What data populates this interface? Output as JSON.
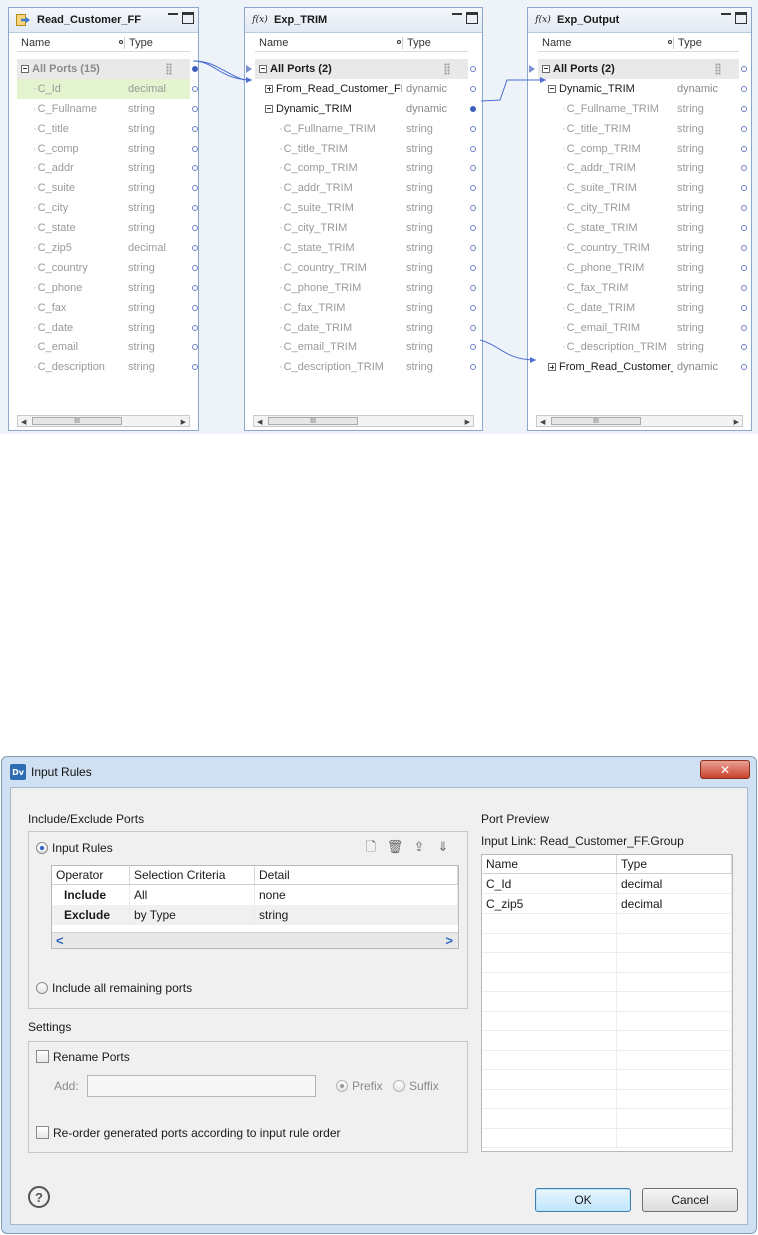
{
  "mapping": {
    "transformations": [
      {
        "title": "Read_Customer_FF",
        "col_name": "Name",
        "col_type": "Type",
        "group": {
          "label": "All Ports (15)"
        },
        "rows": [
          {
            "name": "C_Id",
            "type": "decimal"
          },
          {
            "name": "C_Fullname",
            "type": "string"
          },
          {
            "name": "C_title",
            "type": "string"
          },
          {
            "name": "C_comp",
            "type": "string"
          },
          {
            "name": "C_addr",
            "type": "string"
          },
          {
            "name": "C_suite",
            "type": "string"
          },
          {
            "name": "C_city",
            "type": "string"
          },
          {
            "name": "C_state",
            "type": "string"
          },
          {
            "name": "C_zip5",
            "type": "decimal"
          },
          {
            "name": "C_country",
            "type": "string"
          },
          {
            "name": "C_phone",
            "type": "string"
          },
          {
            "name": "C_fax",
            "type": "string"
          },
          {
            "name": "C_date",
            "type": "string"
          },
          {
            "name": "C_email",
            "type": "string"
          },
          {
            "name": "C_description",
            "type": "string"
          }
        ]
      },
      {
        "title": "Exp_TRIM",
        "icon": "f(x)",
        "col_name": "Name",
        "col_type": "Type",
        "group": {
          "label": "All Ports (2)"
        },
        "rows": [
          {
            "name": "From_Read_Customer_FF",
            "type": "dynamic",
            "kind": "collapsed"
          },
          {
            "name": "Dynamic_TRIM",
            "type": "dynamic",
            "kind": "expanded"
          },
          {
            "name": "C_Fullname_TRIM",
            "type": "string"
          },
          {
            "name": "C_title_TRIM",
            "type": "string"
          },
          {
            "name": "C_comp_TRIM",
            "type": "string"
          },
          {
            "name": "C_addr_TRIM",
            "type": "string"
          },
          {
            "name": "C_suite_TRIM",
            "type": "string"
          },
          {
            "name": "C_city_TRIM",
            "type": "string"
          },
          {
            "name": "C_state_TRIM",
            "type": "string"
          },
          {
            "name": "C_country_TRIM",
            "type": "string"
          },
          {
            "name": "C_phone_TRIM",
            "type": "string"
          },
          {
            "name": "C_fax_TRIM",
            "type": "string"
          },
          {
            "name": "C_date_TRIM",
            "type": "string"
          },
          {
            "name": "C_email_TRIM",
            "type": "string"
          },
          {
            "name": "C_description_TRIM",
            "type": "string"
          }
        ]
      },
      {
        "title": "Exp_Output",
        "icon": "f(x)",
        "col_name": "Name",
        "col_type": "Type",
        "group": {
          "label": "All Ports (2)"
        },
        "rows": [
          {
            "name": "Dynamic_TRIM",
            "type": "dynamic",
            "kind": "expanded"
          },
          {
            "name": "C_Fullname_TRIM",
            "type": "string"
          },
          {
            "name": "C_title_TRIM",
            "type": "string"
          },
          {
            "name": "C_comp_TRIM",
            "type": "string"
          },
          {
            "name": "C_addr_TRIM",
            "type": "string"
          },
          {
            "name": "C_suite_TRIM",
            "type": "string"
          },
          {
            "name": "C_city_TRIM",
            "type": "string"
          },
          {
            "name": "C_state_TRIM",
            "type": "string"
          },
          {
            "name": "C_country_TRIM",
            "type": "string"
          },
          {
            "name": "C_phone_TRIM",
            "type": "string"
          },
          {
            "name": "C_fax_TRIM",
            "type": "string"
          },
          {
            "name": "C_date_TRIM",
            "type": "string"
          },
          {
            "name": "C_email_TRIM",
            "type": "string"
          },
          {
            "name": "C_description_TRIM",
            "type": "string"
          },
          {
            "name": "From_Read_Customer_FF",
            "type": "dynamic",
            "kind": "collapsed"
          }
        ]
      }
    ],
    "scrollbar_thumb": "III"
  },
  "dialog": {
    "title": "Input Rules",
    "icon_text": "Dv",
    "close_glyph": "✕",
    "include_exclude_label": "Include/Exclude Ports",
    "input_rules_radio": "Input Rules",
    "toolbar_icons": [
      "new-rule-icon",
      "delete-rule-icon",
      "move-up-icon",
      "move-down-icon"
    ],
    "rules_table": {
      "headers": [
        "Operator",
        "Selection Criteria",
        "Detail"
      ],
      "rows": [
        {
          "operator": "Include",
          "criteria": "All",
          "detail": "none"
        },
        {
          "operator": "Exclude",
          "criteria": "by Type",
          "detail": "string"
        }
      ]
    },
    "include_remaining_radio": "Include all remaining ports",
    "settings_label": "Settings",
    "rename_ports_label": "Rename Ports",
    "add_label": "Add:",
    "add_value": "",
    "prefix_label": "Prefix",
    "suffix_label": "Suffix",
    "reorder_label": "Re-order generated ports according to input rule order",
    "port_preview_label": "Port Preview",
    "input_link_label": "Input Link: Read_Customer_FF.Group",
    "preview_table": {
      "headers": [
        "Name",
        "Type"
      ],
      "rows": [
        {
          "name": "C_Id",
          "type": "decimal"
        },
        {
          "name": "C_zip5",
          "type": "decimal"
        }
      ]
    },
    "help_glyph": "?",
    "ok_label": "OK",
    "cancel_label": "Cancel",
    "accent_color": "#2a64c2",
    "close_color": "#c9422c"
  }
}
